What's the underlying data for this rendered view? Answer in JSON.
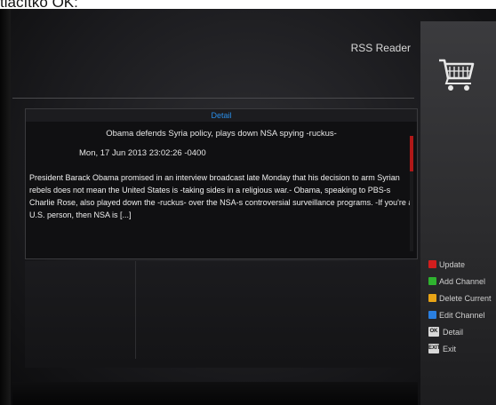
{
  "caption": "tlačítko OK:",
  "screen": {
    "title": "RSS Reader",
    "cart_icon": "shopping-cart-icon"
  },
  "detail": {
    "header": "Detail",
    "headline": "Obama defends Syria policy, plays down NSA spying -ruckus-",
    "date": "Mon, 17 Jun 2013 23:02:26 -0400",
    "body": "President Barack Obama promised in an interview broadcast late Monday that his decision to arm Syrian rebels does not mean the United States is -taking sides in a religious war.- Obama, speaking to PBS-s Charlie Rose, also played down the -ruckus- over the NSA-s controversial surveillance programs. -If you're a U.S. person, then NSA is [...]"
  },
  "legend": {
    "items": [
      {
        "label": "Update",
        "color": "#d21e1e"
      },
      {
        "label": "Add Channel",
        "color": "#2fb32f"
      },
      {
        "label": "Delete Current",
        "color": "#e8a416"
      },
      {
        "label": "Edit Channel",
        "color": "#2a7fe0"
      }
    ],
    "ok_key": "OK",
    "ok_label": "Detail",
    "exit_key": "EXIT",
    "exit_label": "Exit"
  }
}
